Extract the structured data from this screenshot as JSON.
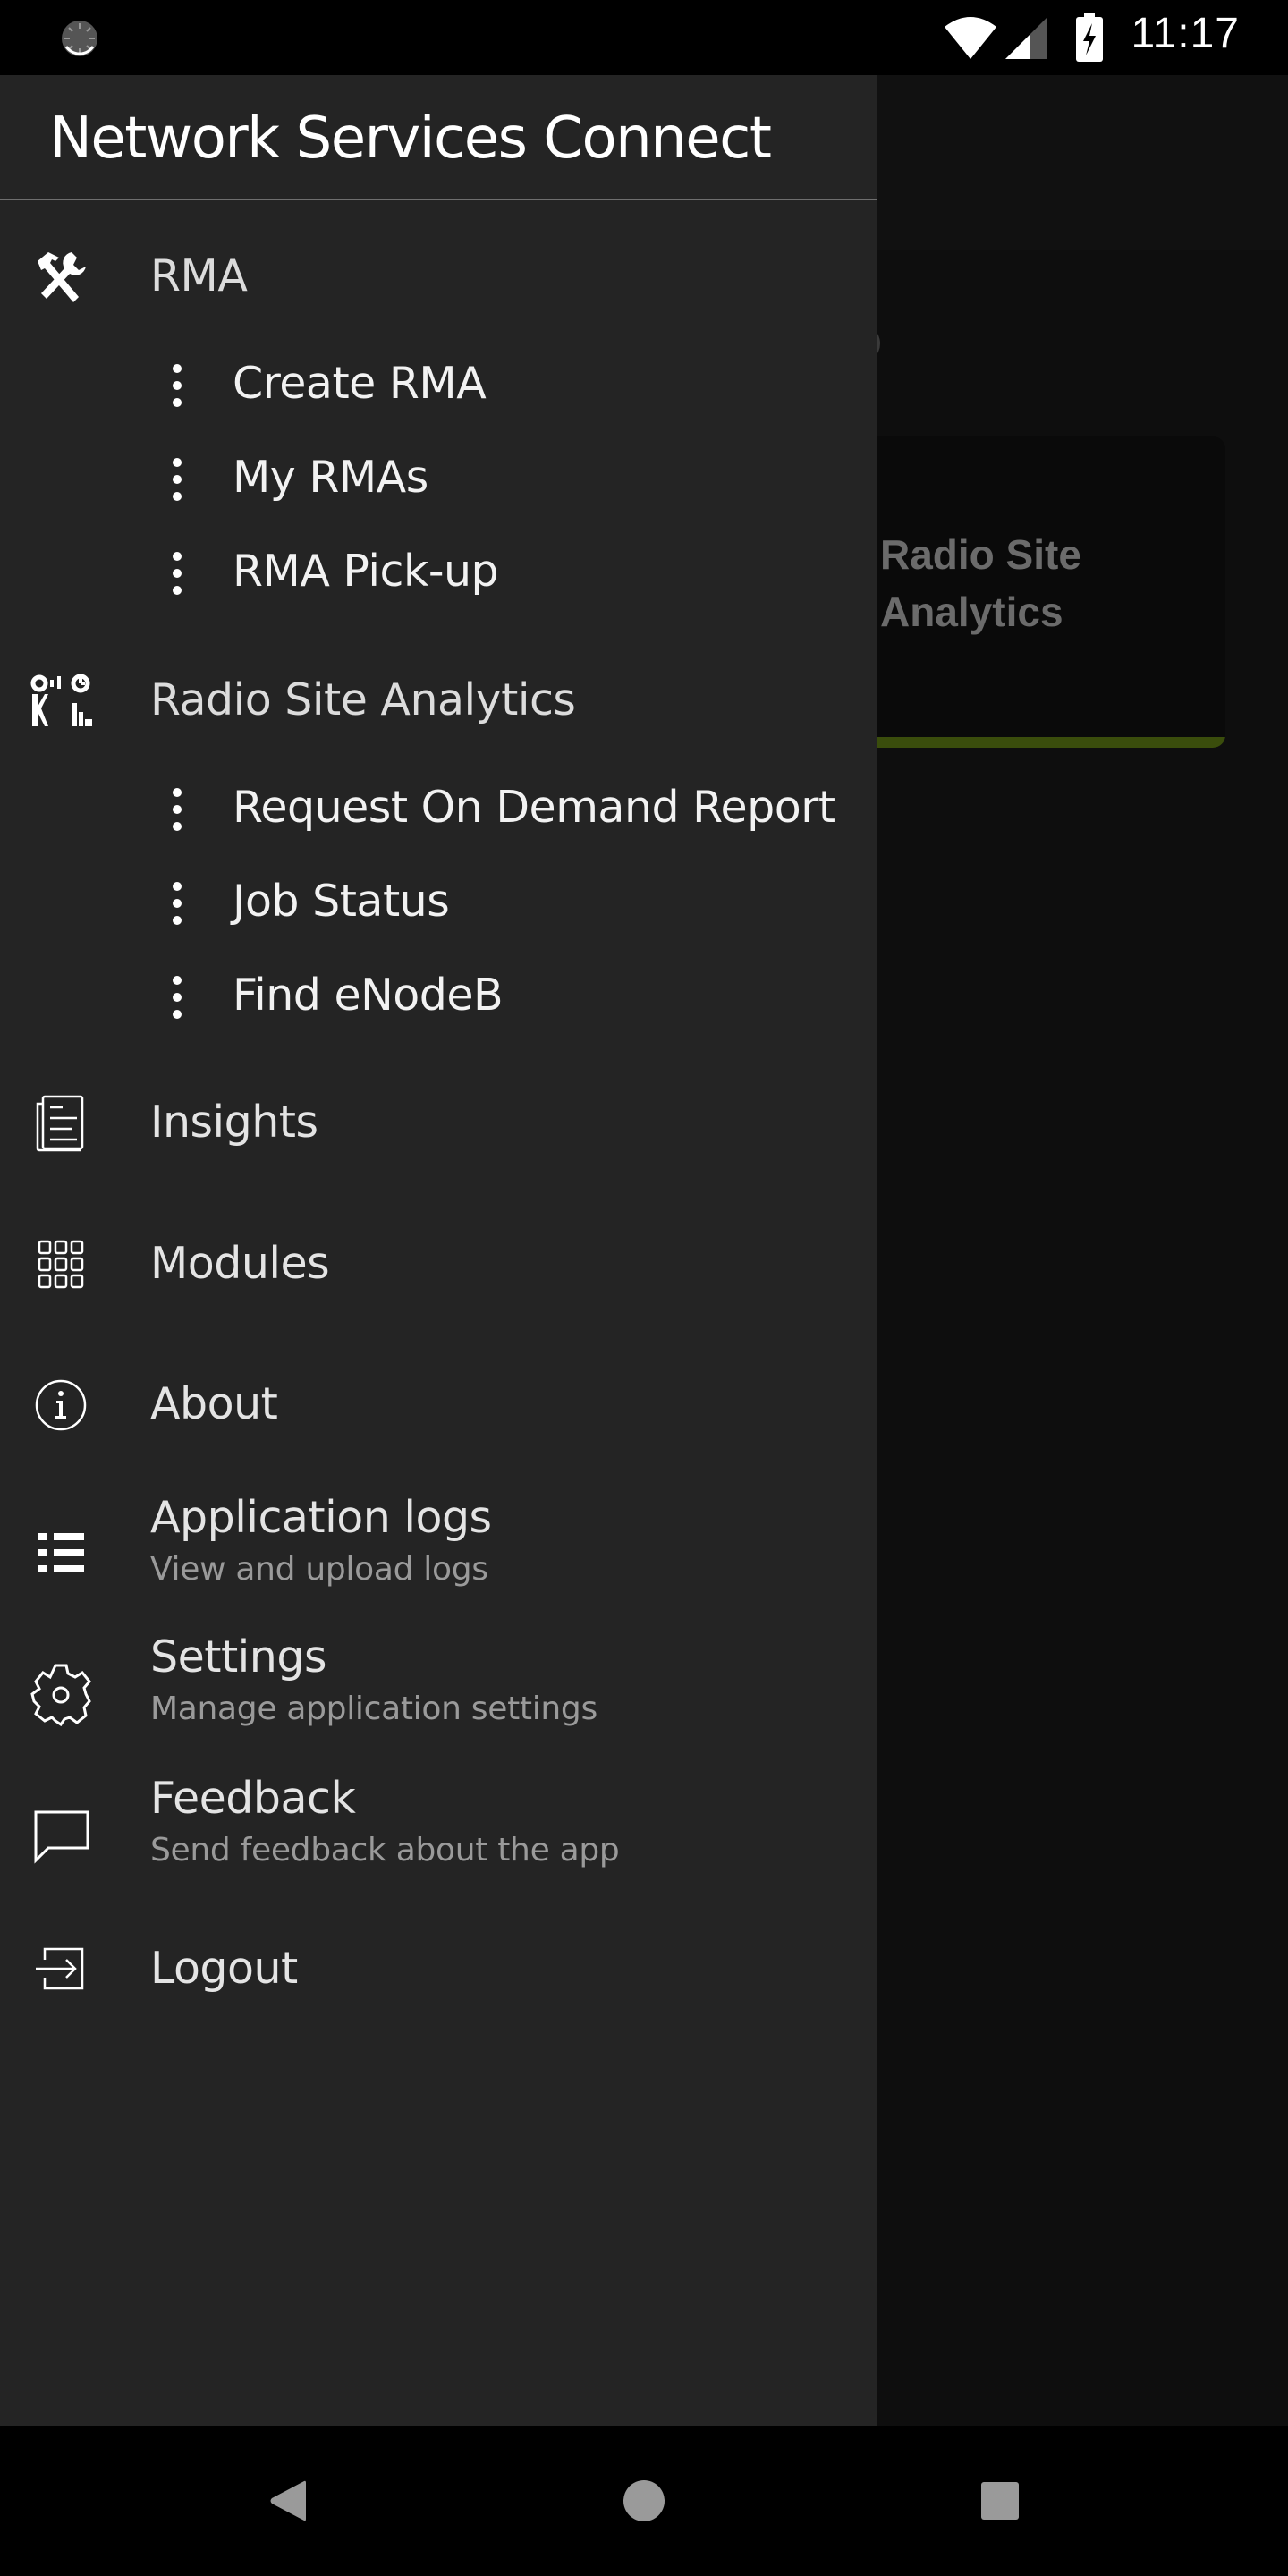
{
  "status_bar": {
    "time": "11:17",
    "icons": [
      "sync-icon",
      "wifi-icon",
      "cell-signal-icon",
      "battery-charging-icon"
    ]
  },
  "background": {
    "card_title": "Radio Site Analytics",
    "card_accent_color": "#3a4d0c"
  },
  "drawer": {
    "title": "Network Services Connect",
    "sections": [
      {
        "label": "RMA",
        "icon": "tools-icon",
        "children": [
          "Create RMA",
          "My RMAs",
          "RMA Pick-up"
        ]
      },
      {
        "label": "Radio Site Analytics",
        "icon": "radio-site-analytics-icon",
        "children": [
          "Request On Demand Report",
          "Job Status",
          "Find eNodeB"
        ]
      }
    ],
    "items": [
      {
        "label": "Insights",
        "icon": "document-icon"
      },
      {
        "label": "Modules",
        "icon": "grid-icon"
      },
      {
        "label": "About",
        "icon": "info-icon"
      },
      {
        "label": "Application logs",
        "subtitle": "View and upload logs",
        "icon": "list-icon"
      },
      {
        "label": "Settings",
        "subtitle": "Manage application settings",
        "icon": "gear-icon"
      },
      {
        "label": "Feedback",
        "subtitle": "Send feedback about the app",
        "icon": "chat-bubble-icon"
      },
      {
        "label": "Logout",
        "icon": "logout-icon"
      }
    ]
  },
  "nav_bar": {
    "buttons": [
      "back",
      "home",
      "recents"
    ]
  }
}
